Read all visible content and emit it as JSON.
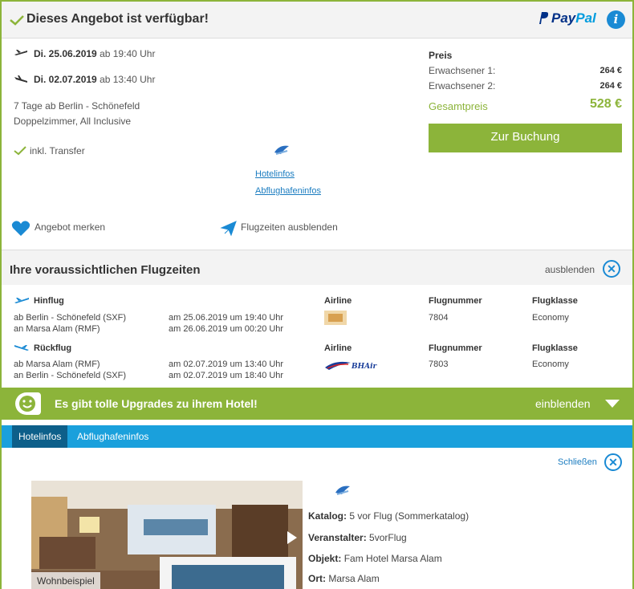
{
  "header": {
    "title": "Dieses Angebot ist verfügbar!",
    "paypal_a": "Pay",
    "paypal_b": "Pal",
    "info": "i"
  },
  "flights": {
    "outbound": {
      "date": "Di. 25.06.2019",
      "time": "ab 19:40 Uhr"
    },
    "return": {
      "date": "Di. 02.07.2019",
      "time": "ab 13:40 Uhr"
    }
  },
  "trip": {
    "duration": "7 Tage ab Berlin - Schönefeld",
    "board": "Doppelzimmer, All Inclusive",
    "transfer": "inkl. Transfer"
  },
  "links": {
    "hotelinfos": "Hotelinfos",
    "airportinfos": "Abflughafeninfos"
  },
  "price": {
    "heading": "Preis",
    "adult1_label": "Erwachsener 1:",
    "adult1_value": "264 €",
    "adult2_label": "Erwachsener 2:",
    "adult2_value": "264 €",
    "total_label": "Gesamtpreis",
    "total_value": "528 €",
    "book_button": "Zur Buchung"
  },
  "actions": {
    "remember": "Angebot merken",
    "hide_times": "Flugzeiten ausblenden"
  },
  "flight_times": {
    "title": "Ihre voraussichtlichen Flugzeiten",
    "hide": "ausblenden",
    "headers": {
      "airline": "Airline",
      "flightno": "Flugnummer",
      "class": "Flugklasse"
    },
    "outbound": {
      "label": "Hinflug",
      "from": "ab Berlin - Schönefeld (SXF)",
      "to": "an Marsa Alam (RMF)",
      "dep": "am 25.06.2019 um 19:40 Uhr",
      "arr": "am 26.06.2019 um 00:20 Uhr",
      "flightno": "7804",
      "class": "Economy"
    },
    "return": {
      "label": "Rückflug",
      "from": "ab Marsa Alam (RMF)",
      "to": "an Berlin - Schönefeld (SXF)",
      "dep": "am 02.07.2019 um 13:40 Uhr",
      "arr": "am 02.07.2019 um 18:40 Uhr",
      "flightno": "7803",
      "class": "Economy",
      "airline_logo": "BHAir"
    }
  },
  "upgrade": {
    "text": "Es gibt tolle Upgrades zu ihrem Hotel!",
    "show": "einblenden"
  },
  "tabs": [
    "Hotelinfos",
    "Abflughafeninfos"
  ],
  "hotel": {
    "close": "Schließen",
    "photo_caption": "Wohnbeispiel",
    "katalog_label": "Katalog:",
    "katalog_value": "5 vor Flug (Sommerkatalog)",
    "veranstalter_label": "Veranstalter:",
    "veranstalter_value": "5vorFlug",
    "objekt_label": "Objekt:",
    "objekt_value": "Fam Hotel Marsa Alam",
    "ort_label": "Ort:",
    "ort_value": "Marsa Alam"
  },
  "colors": {
    "accent": "#8cb43a",
    "blue": "#1a8ad4",
    "tabbar": "#1aa0dc"
  }
}
